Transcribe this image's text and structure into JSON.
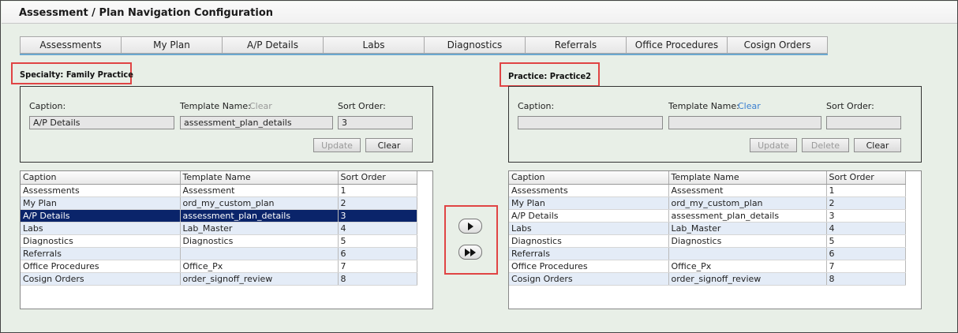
{
  "window": {
    "title": "Assessment / Plan Navigation Configuration"
  },
  "tabs": [
    "Assessments",
    "My Plan",
    "A/P Details",
    "Labs",
    "Diagnostics",
    "Referrals",
    "Office Procedures",
    "Cosign Orders"
  ],
  "left": {
    "scope_label": "Specialty: Family Practice",
    "caption_label": "Caption:",
    "template_label": "Template Name:",
    "template_clear": "Clear",
    "sort_label": "Sort Order:",
    "caption_value": "A/P Details",
    "template_value": "assessment_plan_details",
    "sort_value": "3",
    "update_label": "Update",
    "clear_label": "Clear",
    "columns": [
      "Caption",
      "Template Name",
      "Sort Order"
    ],
    "rows": [
      [
        "Assessments",
        "Assessment",
        "1"
      ],
      [
        "My Plan",
        "ord_my_custom_plan",
        "2"
      ],
      [
        "A/P Details",
        "assessment_plan_details",
        "3"
      ],
      [
        "Labs",
        "Lab_Master",
        "4"
      ],
      [
        "Diagnostics",
        "Diagnostics",
        "5"
      ],
      [
        "Referrals",
        "",
        "6"
      ],
      [
        "Office Procedures",
        "Office_Px",
        "7"
      ],
      [
        "Cosign Orders",
        "order_signoff_review",
        "8"
      ]
    ]
  },
  "right": {
    "scope_label": "Practice: Practice2",
    "caption_label": "Caption:",
    "template_label": "Template Name:",
    "template_clear": "Clear",
    "sort_label": "Sort Order:",
    "caption_value": "",
    "template_value": "",
    "sort_value": "",
    "update_label": "Update",
    "delete_label": "Delete",
    "clear_label": "Clear",
    "columns": [
      "Caption",
      "Template Name",
      "Sort Order"
    ],
    "rows": [
      [
        "Assessments",
        "Assessment",
        "1"
      ],
      [
        "My Plan",
        "ord_my_custom_plan",
        "2"
      ],
      [
        "A/P Details",
        "assessment_plan_details",
        "3"
      ],
      [
        "Labs",
        "Lab_Master",
        "4"
      ],
      [
        "Diagnostics",
        "Diagnostics",
        "5"
      ],
      [
        "Referrals",
        "",
        "6"
      ],
      [
        "Office Procedures",
        "Office_Px",
        "7"
      ],
      [
        "Cosign Orders",
        "order_signoff_review",
        "8"
      ]
    ]
  },
  "transfer": {
    "move_one_icon": "play-icon",
    "move_all_icon": "fast-forward-icon"
  },
  "colors": {
    "selected_row": "#0a246a",
    "highlight_box": "#e04444",
    "link": "#3a7fd0"
  }
}
